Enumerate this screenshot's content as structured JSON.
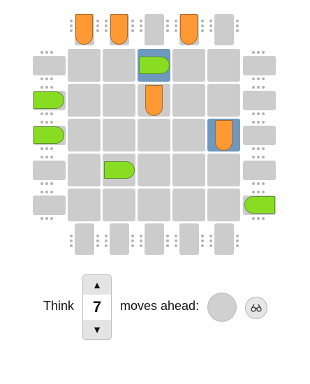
{
  "game": {
    "title": "",
    "colors": {
      "cell": "#cccccc",
      "highlight": "#6e98bd",
      "orange_piece": "#ff9933",
      "green_piece": "#88dd22",
      "dot": "#b3b3b3"
    },
    "board": {
      "rows": 5,
      "cols": 5
    },
    "highlighted_cells": [
      [
        0,
        2
      ],
      [
        2,
        4
      ]
    ],
    "pieces": [
      {
        "color": "orange",
        "where": "top-home",
        "index": 0,
        "facing": "down"
      },
      {
        "color": "orange",
        "where": "top-home",
        "index": 1,
        "facing": "down"
      },
      {
        "color": "orange",
        "where": "top-home",
        "index": 3,
        "facing": "down"
      },
      {
        "color": "orange",
        "where": "board",
        "row": 1,
        "col": 2,
        "facing": "down"
      },
      {
        "color": "orange",
        "where": "board",
        "row": 2,
        "col": 4,
        "facing": "down"
      },
      {
        "color": "green",
        "where": "left-home",
        "index": 1,
        "facing": "right"
      },
      {
        "color": "green",
        "where": "left-home",
        "index": 2,
        "facing": "right"
      },
      {
        "color": "green",
        "where": "board",
        "row": 0,
        "col": 2,
        "facing": "right"
      },
      {
        "color": "green",
        "where": "board",
        "row": 3,
        "col": 1,
        "facing": "right"
      },
      {
        "color": "green",
        "where": "right-home",
        "index": 4,
        "facing": "left"
      }
    ]
  },
  "controls": {
    "think_label": "Think",
    "moves_ahead_label": "moves ahead:",
    "moves_ahead_value": "7",
    "spin_up_icon": "up-triangle-icon",
    "spin_down_icon": "down-triangle-icon",
    "spin_up_glyph": "▲",
    "spin_down_glyph": "▼",
    "help_icon": "glasses-icon"
  }
}
